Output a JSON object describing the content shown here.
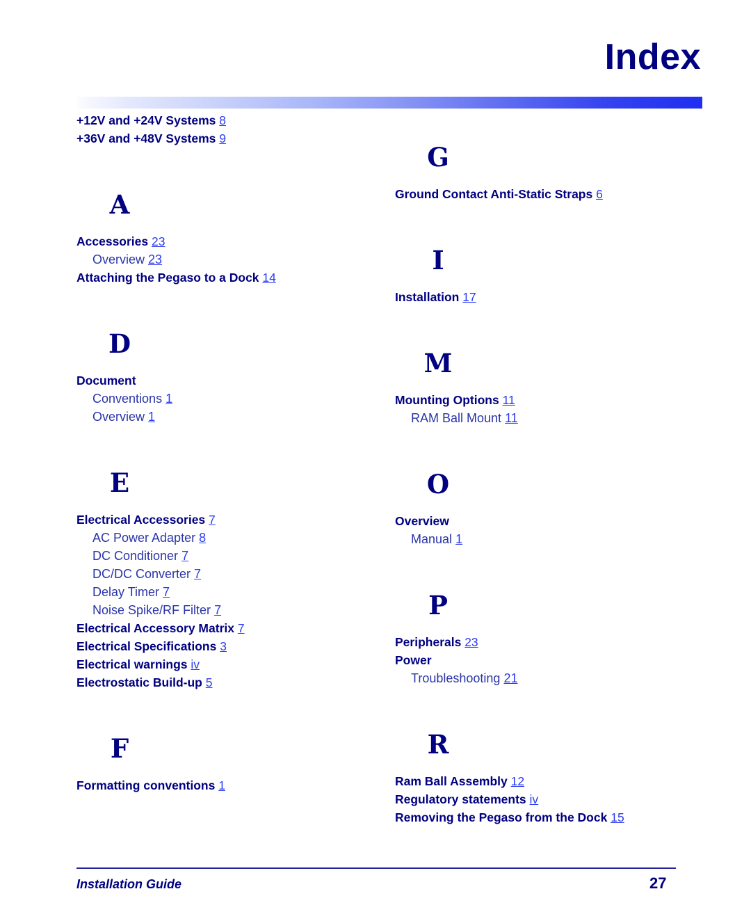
{
  "header": {
    "title": "Index"
  },
  "footer": {
    "guide_label": "Installation Guide",
    "page_number": "27"
  },
  "colors": {
    "heading_navy": "#000080",
    "sub_entry_blue": "#2a35a8",
    "page_link_blue": "#2b3cf0",
    "gradient_start": "#fbfcff",
    "gradient_end": "#1f2ef0",
    "footer_rule": "#24249c"
  },
  "columns": {
    "left": {
      "preamble": [
        {
          "text": "+12V and +24V Systems",
          "page": "8"
        },
        {
          "text": "+36V and +48V Systems",
          "page": "9"
        }
      ],
      "sections": [
        {
          "letter": "A",
          "entries": [
            {
              "text": "Accessories",
              "page": "23",
              "level": "main"
            },
            {
              "text": "Overview",
              "page": "23",
              "level": "sub"
            },
            {
              "text": "Attaching the Pegaso to a Dock",
              "page": "14",
              "level": "main"
            }
          ]
        },
        {
          "letter": "D",
          "entries": [
            {
              "text": "Document",
              "page": "",
              "level": "main"
            },
            {
              "text": "Conventions",
              "page": "1",
              "level": "sub"
            },
            {
              "text": "Overview",
              "page": "1",
              "level": "sub"
            }
          ]
        },
        {
          "letter": "E",
          "entries": [
            {
              "text": "Electrical Accessories",
              "page": "7",
              "level": "main"
            },
            {
              "text": "AC Power Adapter",
              "page": "8",
              "level": "sub"
            },
            {
              "text": "DC Conditioner",
              "page": "7",
              "level": "sub"
            },
            {
              "text": "DC/DC Converter",
              "page": "7",
              "level": "sub"
            },
            {
              "text": "Delay Timer",
              "page": "7",
              "level": "sub"
            },
            {
              "text": "Noise Spike/RF Filter",
              "page": "7",
              "level": "sub"
            },
            {
              "text": "Electrical Accessory Matrix",
              "page": "7",
              "level": "main"
            },
            {
              "text": "Electrical Specifications",
              "page": "3",
              "level": "main"
            },
            {
              "text": "Electrical warnings",
              "page": "iv",
              "level": "main"
            },
            {
              "text": "Electrostatic Build-up",
              "page": "5",
              "level": "main"
            }
          ]
        },
        {
          "letter": "F",
          "entries": [
            {
              "text": "Formatting conventions",
              "page": "1",
              "level": "main"
            }
          ]
        }
      ]
    },
    "right": {
      "sections": [
        {
          "letter": "G",
          "entries": [
            {
              "text": "Ground Contact Anti-Static Straps",
              "page": "6",
              "level": "main"
            }
          ]
        },
        {
          "letter": "I",
          "entries": [
            {
              "text": "Installation",
              "page": "17",
              "level": "main"
            }
          ]
        },
        {
          "letter": "M",
          "entries": [
            {
              "text": "Mounting Options",
              "page": "11",
              "level": "main"
            },
            {
              "text": "RAM Ball Mount",
              "page": "11",
              "level": "sub"
            }
          ]
        },
        {
          "letter": "O",
          "entries": [
            {
              "text": "Overview",
              "page": "",
              "level": "main"
            },
            {
              "text": "Manual",
              "page": "1",
              "level": "sub"
            }
          ]
        },
        {
          "letter": "P",
          "entries": [
            {
              "text": "Peripherals",
              "page": "23",
              "level": "main"
            },
            {
              "text": "Power",
              "page": "",
              "level": "main"
            },
            {
              "text": "Troubleshooting",
              "page": "21",
              "level": "sub"
            }
          ]
        },
        {
          "letter": "R",
          "entries": [
            {
              "text": "Ram Ball Assembly",
              "page": "12",
              "level": "main"
            },
            {
              "text": "Regulatory statements",
              "page": "iv",
              "level": "main"
            },
            {
              "text": "Removing the Pegaso from the Dock",
              "page": "15",
              "level": "main"
            }
          ]
        }
      ]
    }
  }
}
